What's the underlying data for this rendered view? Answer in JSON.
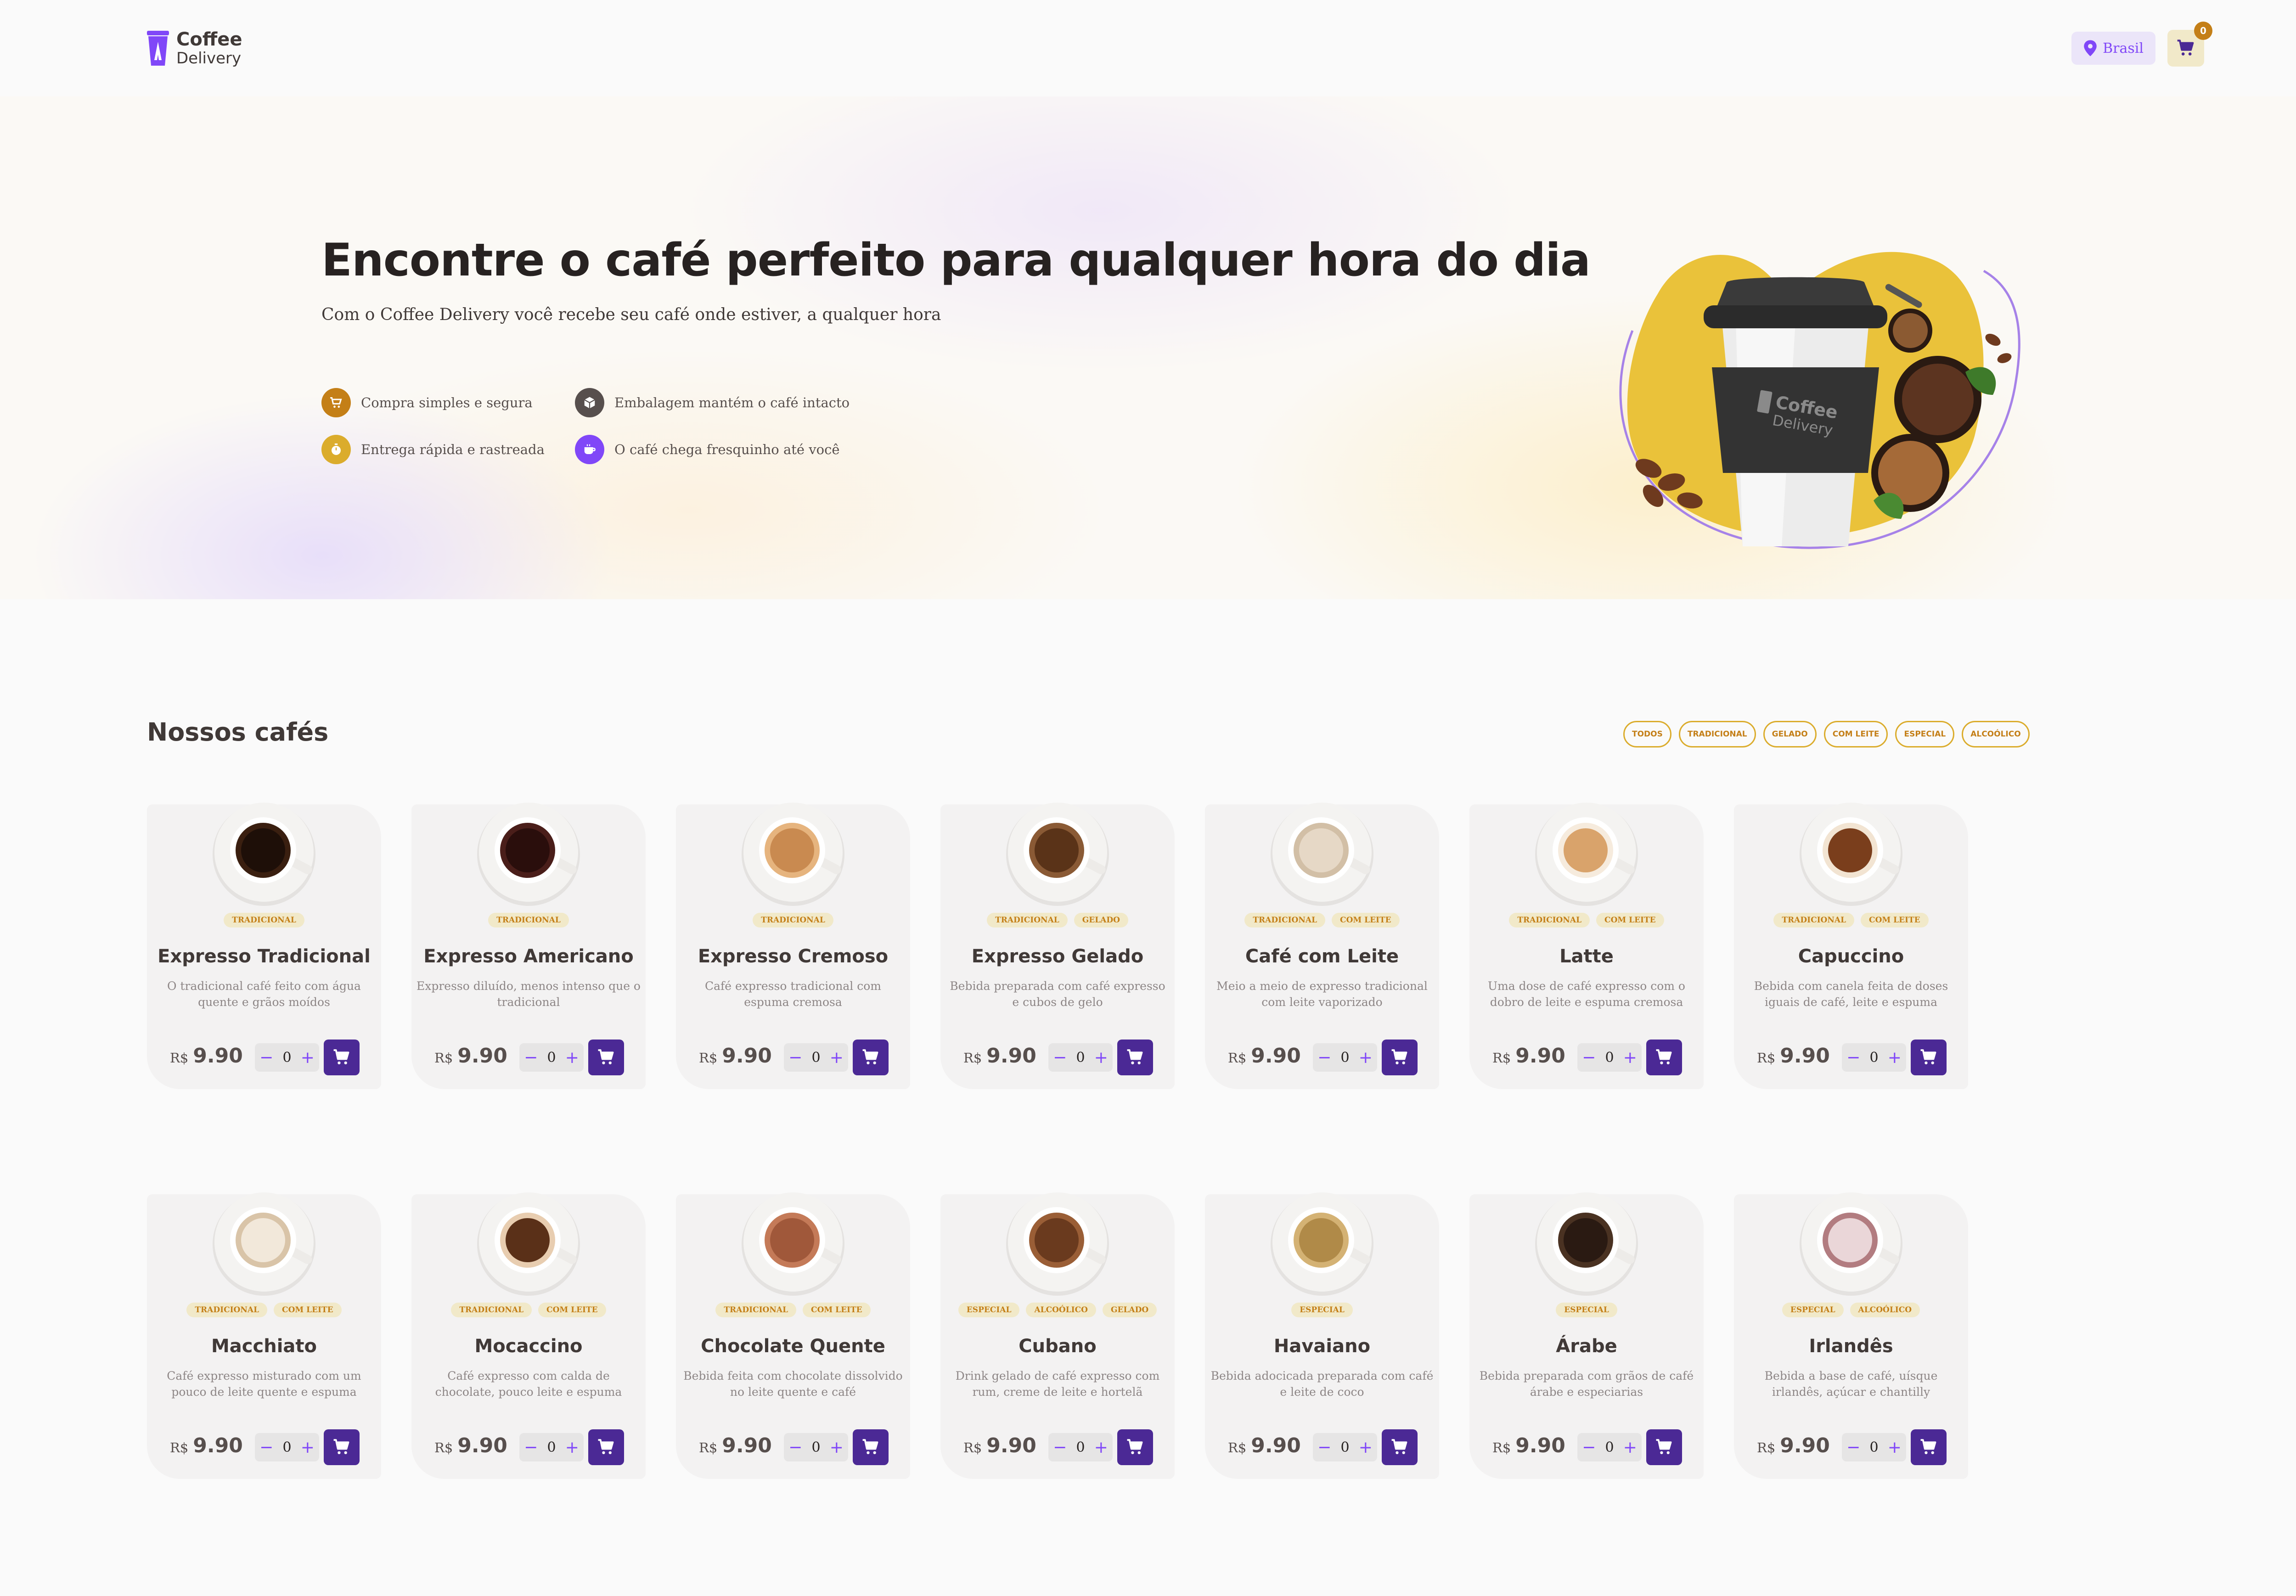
{
  "header": {
    "logo_line1": "Coffee",
    "logo_line2": "Delivery",
    "location": "Brasil",
    "cart_count": "0"
  },
  "hero": {
    "title": "Encontre o café perfeito para qualquer hora do dia",
    "subtitle": "Com o Coffee Delivery você recebe seu café onde estiver, a qualquer hora",
    "features": [
      {
        "label": "Compra simples e segura",
        "icon": "cart-icon",
        "color": "#C47F17"
      },
      {
        "label": "Embalagem mantém o café intacto",
        "icon": "package-icon",
        "color": "#574F4D"
      },
      {
        "label": "Entrega rápida e rastreada",
        "icon": "timer-icon",
        "color": "#DBAC2C"
      },
      {
        "label": "O café chega fresquinho até você",
        "icon": "coffee-icon",
        "color": "#8047F8"
      }
    ],
    "art_logo_line1": "Coffee",
    "art_logo_line2": "Delivery"
  },
  "catalog": {
    "title": "Nossos cafés",
    "filters": [
      "TODOS",
      "TRADICIONAL",
      "GELADO",
      "COM LEITE",
      "ESPECIAL",
      "ALCOÓLICO"
    ],
    "currency": "R$",
    "coffees": [
      {
        "name": "Expresso Tradicional",
        "description": "O tradicional café feito com água quente e grãos moídos",
        "tags": [
          "TRADICIONAL"
        ],
        "price": "9.90",
        "quantity": "0",
        "liquid": "#1E0F08",
        "foam": "#3A1F10"
      },
      {
        "name": "Expresso Americano",
        "description": "Expresso diluído, menos intenso que o tradicional",
        "tags": [
          "TRADICIONAL"
        ],
        "price": "9.90",
        "quantity": "0",
        "liquid": "#2A0E0C",
        "foam": "#4A1E1A"
      },
      {
        "name": "Expresso Cremoso",
        "description": "Café expresso tradicional com espuma cremosa",
        "tags": [
          "TRADICIONAL"
        ],
        "price": "9.90",
        "quantity": "0",
        "liquid": "#C98A50",
        "foam": "#E6B47E"
      },
      {
        "name": "Expresso Gelado",
        "description": "Bebida preparada com café expresso e cubos de gelo",
        "tags": [
          "TRADICIONAL",
          "GELADO"
        ],
        "price": "9.90",
        "quantity": "0",
        "liquid": "#5A3318",
        "foam": "#8A5A35"
      },
      {
        "name": "Café com Leite",
        "description": "Meio a meio de expresso tradicional com leite vaporizado",
        "tags": [
          "TRADICIONAL",
          "COM LEITE"
        ],
        "price": "9.90",
        "quantity": "0",
        "liquid": "#E6D8C6",
        "foam": "#D2BFA6"
      },
      {
        "name": "Latte",
        "description": "Uma dose de café expresso com o dobro de leite e espuma cremosa",
        "tags": [
          "TRADICIONAL",
          "COM LEITE"
        ],
        "price": "9.90",
        "quantity": "0",
        "liquid": "#D9A36B",
        "foam": "#F6EBDD"
      },
      {
        "name": "Capuccino",
        "description": "Bebida com canela feita de doses iguais de café, leite e espuma",
        "tags": [
          "TRADICIONAL",
          "COM LEITE"
        ],
        "price": "9.90",
        "quantity": "0",
        "liquid": "#7A3E1C",
        "foam": "#F2E4D2"
      },
      {
        "name": "Macchiato",
        "description": "Café expresso misturado com um pouco de leite quente e espuma",
        "tags": [
          "TRADICIONAL",
          "COM LEITE"
        ],
        "price": "9.90",
        "quantity": "0",
        "liquid": "#F2E8DA",
        "foam": "#D9C4A8"
      },
      {
        "name": "Mocaccino",
        "description": "Café expresso com calda de chocolate, pouco leite e espuma",
        "tags": [
          "TRADICIONAL",
          "COM LEITE"
        ],
        "price": "9.90",
        "quantity": "0",
        "liquid": "#5A3018",
        "foam": "#E8CDB0"
      },
      {
        "name": "Chocolate Quente",
        "description": "Bebida feita com chocolate dissolvido no leite quente e café",
        "tags": [
          "TRADICIONAL",
          "COM LEITE"
        ],
        "price": "9.90",
        "quantity": "0",
        "liquid": "#A0583A",
        "foam": "#C47A58"
      },
      {
        "name": "Cubano",
        "description": "Drink gelado de café expresso com rum, creme de leite e hortelã",
        "tags": [
          "ESPECIAL",
          "ALCOÓLICO",
          "GELADO"
        ],
        "price": "9.90",
        "quantity": "0",
        "liquid": "#6A3A1E",
        "foam": "#9A5E36"
      },
      {
        "name": "Havaiano",
        "description": "Bebida adocicada preparada com café e leite de coco",
        "tags": [
          "ESPECIAL"
        ],
        "price": "9.90",
        "quantity": "0",
        "liquid": "#B08A48",
        "foam": "#D4B274"
      },
      {
        "name": "Árabe",
        "description": "Bebida preparada com grãos de café árabe e especiarias",
        "tags": [
          "ESPECIAL"
        ],
        "price": "9.90",
        "quantity": "0",
        "liquid": "#2A1A12",
        "foam": "#4A3222"
      },
      {
        "name": "Irlandês",
        "description": "Bebida a base de café, uísque irlandês, açúcar e chantilly",
        "tags": [
          "ESPECIAL",
          "ALCOÓLICO"
        ],
        "price": "9.90",
        "quantity": "0",
        "liquid": "#EAD6D8",
        "foam": "#B27C80"
      }
    ]
  },
  "colors": {
    "purple_dark": "#4B2995",
    "purple": "#8047F8",
    "purple_light": "#EBE5F9",
    "yellow_dark": "#C47F17",
    "yellow": "#DBAC2C",
    "yellow_light": "#F1E9C9"
  }
}
